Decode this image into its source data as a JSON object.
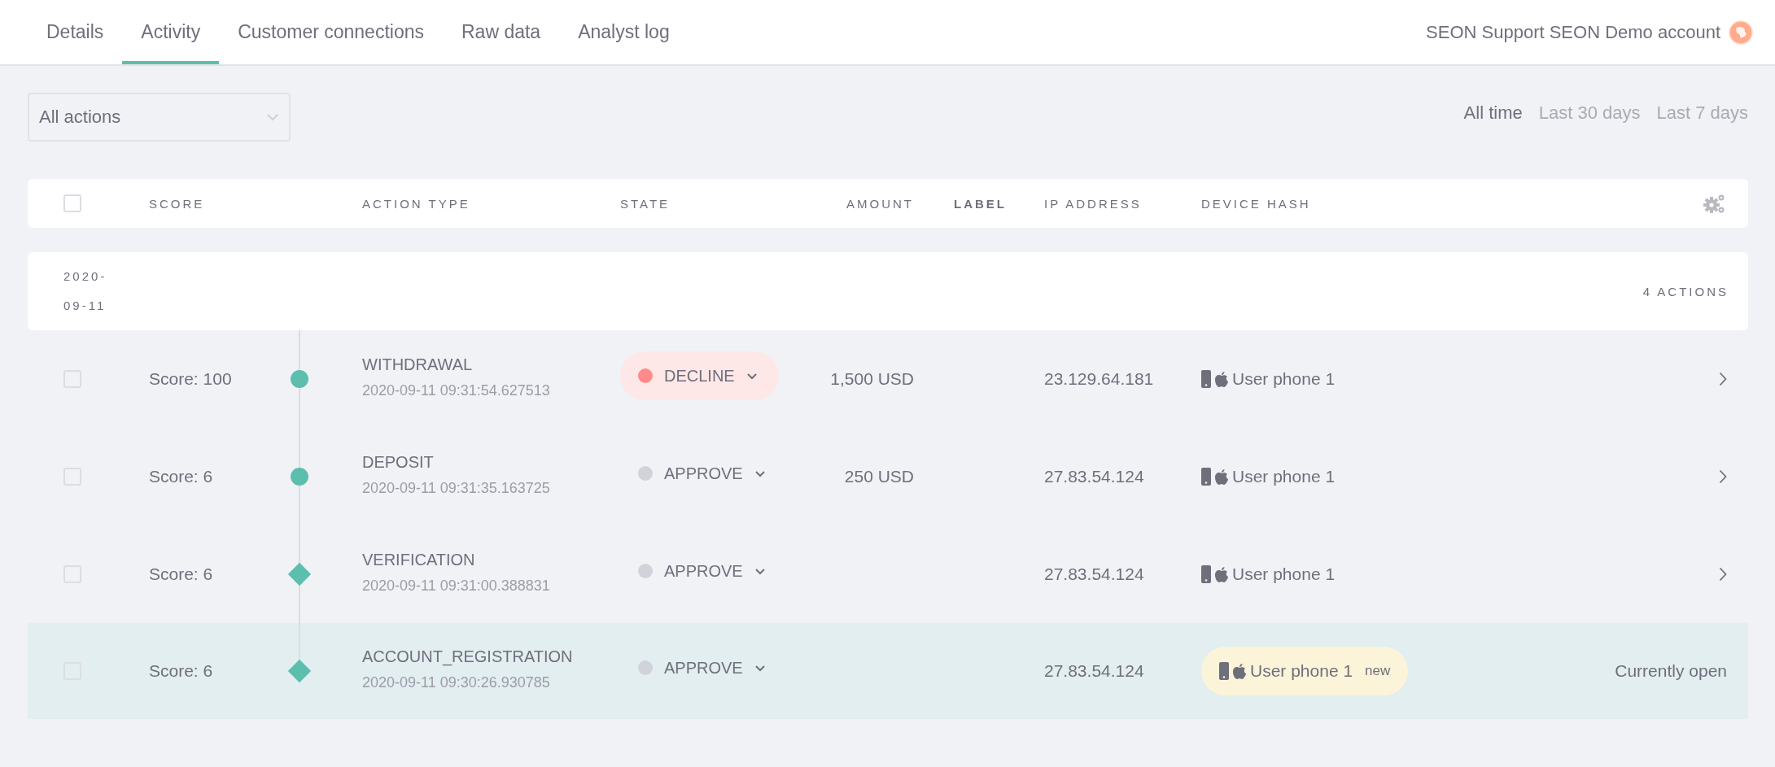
{
  "tabs": [
    {
      "label": "Details",
      "selected": false
    },
    {
      "label": "Activity",
      "selected": true
    },
    {
      "label": "Customer connections",
      "selected": false
    },
    {
      "label": "Raw data",
      "selected": false
    },
    {
      "label": "Analyst log",
      "selected": false
    }
  ],
  "account": {
    "name": "SEON Support SEON Demo account"
  },
  "filter": {
    "value": "All actions"
  },
  "time_ranges": [
    {
      "label": "All time",
      "selected": true
    },
    {
      "label": "Last 30 days",
      "selected": false
    },
    {
      "label": "Last 7 days",
      "selected": false
    }
  ],
  "table": {
    "select_all_checked": false,
    "columns": [
      {
        "label": "SCORE",
        "kind": "score"
      },
      {
        "label": "ACTION TYPE",
        "kind": "action"
      },
      {
        "label": "STATE",
        "kind": "state"
      },
      {
        "label": "AMOUNT",
        "kind": "amount"
      },
      {
        "label": "LABEL",
        "kind": "label"
      },
      {
        "label": "IP ADDRESS",
        "kind": "ip"
      },
      {
        "label": "DEVICE HASH",
        "kind": "device"
      }
    ],
    "groups": [
      {
        "date": "2020-\n09-11",
        "count": "4 ACTIONS",
        "rows": [
          {
            "checked": false,
            "score": "Score: 100",
            "kind": "circle",
            "action": "WITHDRAWAL",
            "timestamp": "2020-09-11 09:31:54.627513",
            "state": {
              "label": "DECLINE",
              "kind": "decline",
              "color": "#ff8a8a"
            },
            "amount": "1,500 USD",
            "ip": "23.129.64.181",
            "device": {
              "name": "User phone 1"
            },
            "current": false
          },
          {
            "checked": false,
            "score": "Score: 6",
            "kind": "circle",
            "action": "DEPOSIT",
            "timestamp": "2020-09-11 09:31:35.163725",
            "state": {
              "label": "APPROVE",
              "kind": "approve",
              "color": "#d2d3da"
            },
            "amount": "250 USD",
            "ip": "27.83.54.124",
            "device": {
              "name": "User phone 1"
            },
            "current": false
          },
          {
            "checked": false,
            "score": "Score: 6",
            "kind": "diamond",
            "action": "VERIFICATION",
            "timestamp": "2020-09-11 09:31:00.388831",
            "state": {
              "label": "APPROVE",
              "kind": "approve",
              "color": "#d2d3da"
            },
            "ip": "27.83.54.124",
            "device": {
              "name": "User phone 1"
            },
            "current": false
          },
          {
            "checked": false,
            "score": "Score: 6",
            "kind": "diamond",
            "action": "ACCOUNT_REGISTRATION",
            "timestamp": "2020-09-11 09:30:26.930785",
            "state": {
              "label": "APPROVE",
              "kind": "approve",
              "color": "#d2d3da"
            },
            "ip": "27.83.54.124",
            "device": {
              "name": "User phone 1",
              "badge": "new"
            },
            "current": true,
            "status_text": "Currently open"
          }
        ]
      }
    ]
  }
}
